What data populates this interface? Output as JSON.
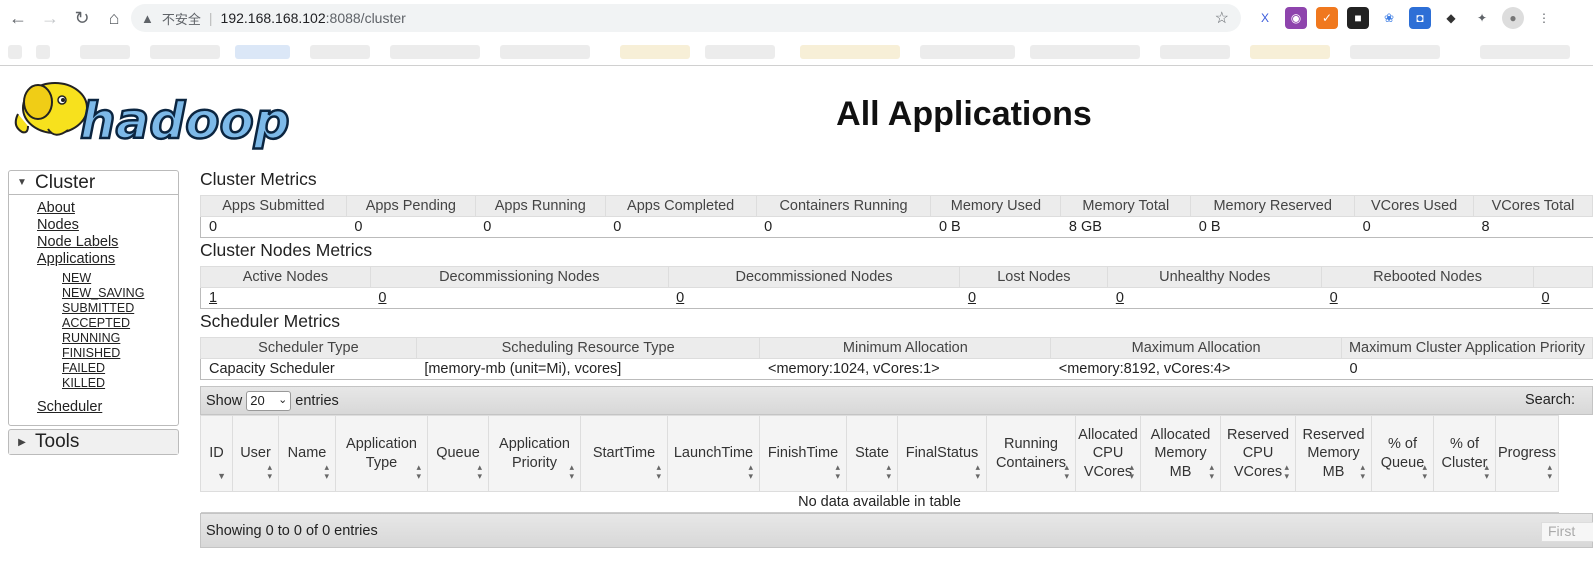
{
  "browser": {
    "insecure_label": "不安全",
    "url_host": "192.168.168.102",
    "url_path": ":8088/cluster",
    "extensions": [
      {
        "name": "x-icon",
        "glyph": "X",
        "color": "#3b5bdb",
        "bg": "#ffffff"
      },
      {
        "name": "color-circle-icon",
        "glyph": "◉",
        "color": "#ffffff",
        "bg": "#8e44ad"
      },
      {
        "name": "orange-ext-icon",
        "glyph": "✓",
        "color": "#ffffff",
        "bg": "#f0781e"
      },
      {
        "name": "dark-ext-icon",
        "glyph": "■",
        "color": "#ffffff",
        "bg": "#222222"
      },
      {
        "name": "translate-icon",
        "glyph": "❀",
        "color": "#3d7de4",
        "bg": "#ffffff"
      },
      {
        "name": "blue-ext-icon",
        "glyph": "◘",
        "color": "#ffffff",
        "bg": "#2d6fd6"
      },
      {
        "name": "cube-icon",
        "glyph": "◆",
        "color": "#333333",
        "bg": "#ffffff"
      },
      {
        "name": "puzzle-icon",
        "glyph": "✦",
        "color": "#5f6368",
        "bg": "#ffffff"
      },
      {
        "name": "profile-avatar-icon",
        "glyph": "●",
        "color": "#777777",
        "bg": "#dddddd"
      },
      {
        "name": "menu-kebab-icon",
        "glyph": "⋮",
        "color": "#5f6368",
        "bg": "#ffffff"
      }
    ]
  },
  "page": {
    "logo_text": "hadoop",
    "title": "All Applications"
  },
  "sidebar": {
    "cluster_label": "Cluster",
    "tools_label": "Tools",
    "links": [
      "About",
      "Nodes",
      "Node Labels",
      "Applications"
    ],
    "app_states": [
      "NEW",
      "NEW_SAVING",
      "SUBMITTED",
      "ACCEPTED",
      "RUNNING",
      "FINISHED",
      "FAILED",
      "KILLED"
    ],
    "scheduler": "Scheduler"
  },
  "cluster_metrics": {
    "title": "Cluster Metrics",
    "headers": [
      "Apps Submitted",
      "Apps Pending",
      "Apps Running",
      "Apps Completed",
      "Containers Running",
      "Memory Used",
      "Memory Total",
      "Memory Reserved",
      "VCores Used",
      "VCores Total"
    ],
    "values": [
      "0",
      "0",
      "0",
      "0",
      "0",
      "0 B",
      "8 GB",
      "0 B",
      "0",
      "8"
    ]
  },
  "node_metrics": {
    "title": "Cluster Nodes Metrics",
    "headers": [
      "Active Nodes",
      "Decommissioning Nodes",
      "Decommissioned Nodes",
      "Lost Nodes",
      "Unhealthy Nodes",
      "Rebooted Nodes",
      ""
    ],
    "values": [
      "1",
      "0",
      "0",
      "0",
      "0",
      "0",
      "0"
    ]
  },
  "scheduler_metrics": {
    "title": "Scheduler Metrics",
    "headers": [
      "Scheduler Type",
      "Scheduling Resource Type",
      "Minimum Allocation",
      "Maximum Allocation",
      "Maximum Cluster Application Priority"
    ],
    "values": [
      "Capacity Scheduler",
      "[memory-mb (unit=Mi), vcores]",
      "<memory:1024, vCores:1>",
      "<memory:8192, vCores:4>",
      "0"
    ]
  },
  "apps_table": {
    "show_label": "Show",
    "page_length": "20",
    "entries_label": "entries",
    "search_label": "Search:",
    "columns": [
      "ID",
      "User",
      "Name",
      "Application Type",
      "Queue",
      "Application Priority",
      "StartTime",
      "LaunchTime",
      "FinishTime",
      "State",
      "FinalStatus",
      "Running Containers",
      "Allocated CPU VCores",
      "Allocated Memory MB",
      "Reserved CPU VCores",
      "Reserved Memory MB",
      "% of Queue",
      "% of Cluster",
      "Progress"
    ],
    "empty_message": "No data available in table",
    "info": "Showing 0 to 0 of 0 entries",
    "first_label": "First"
  }
}
